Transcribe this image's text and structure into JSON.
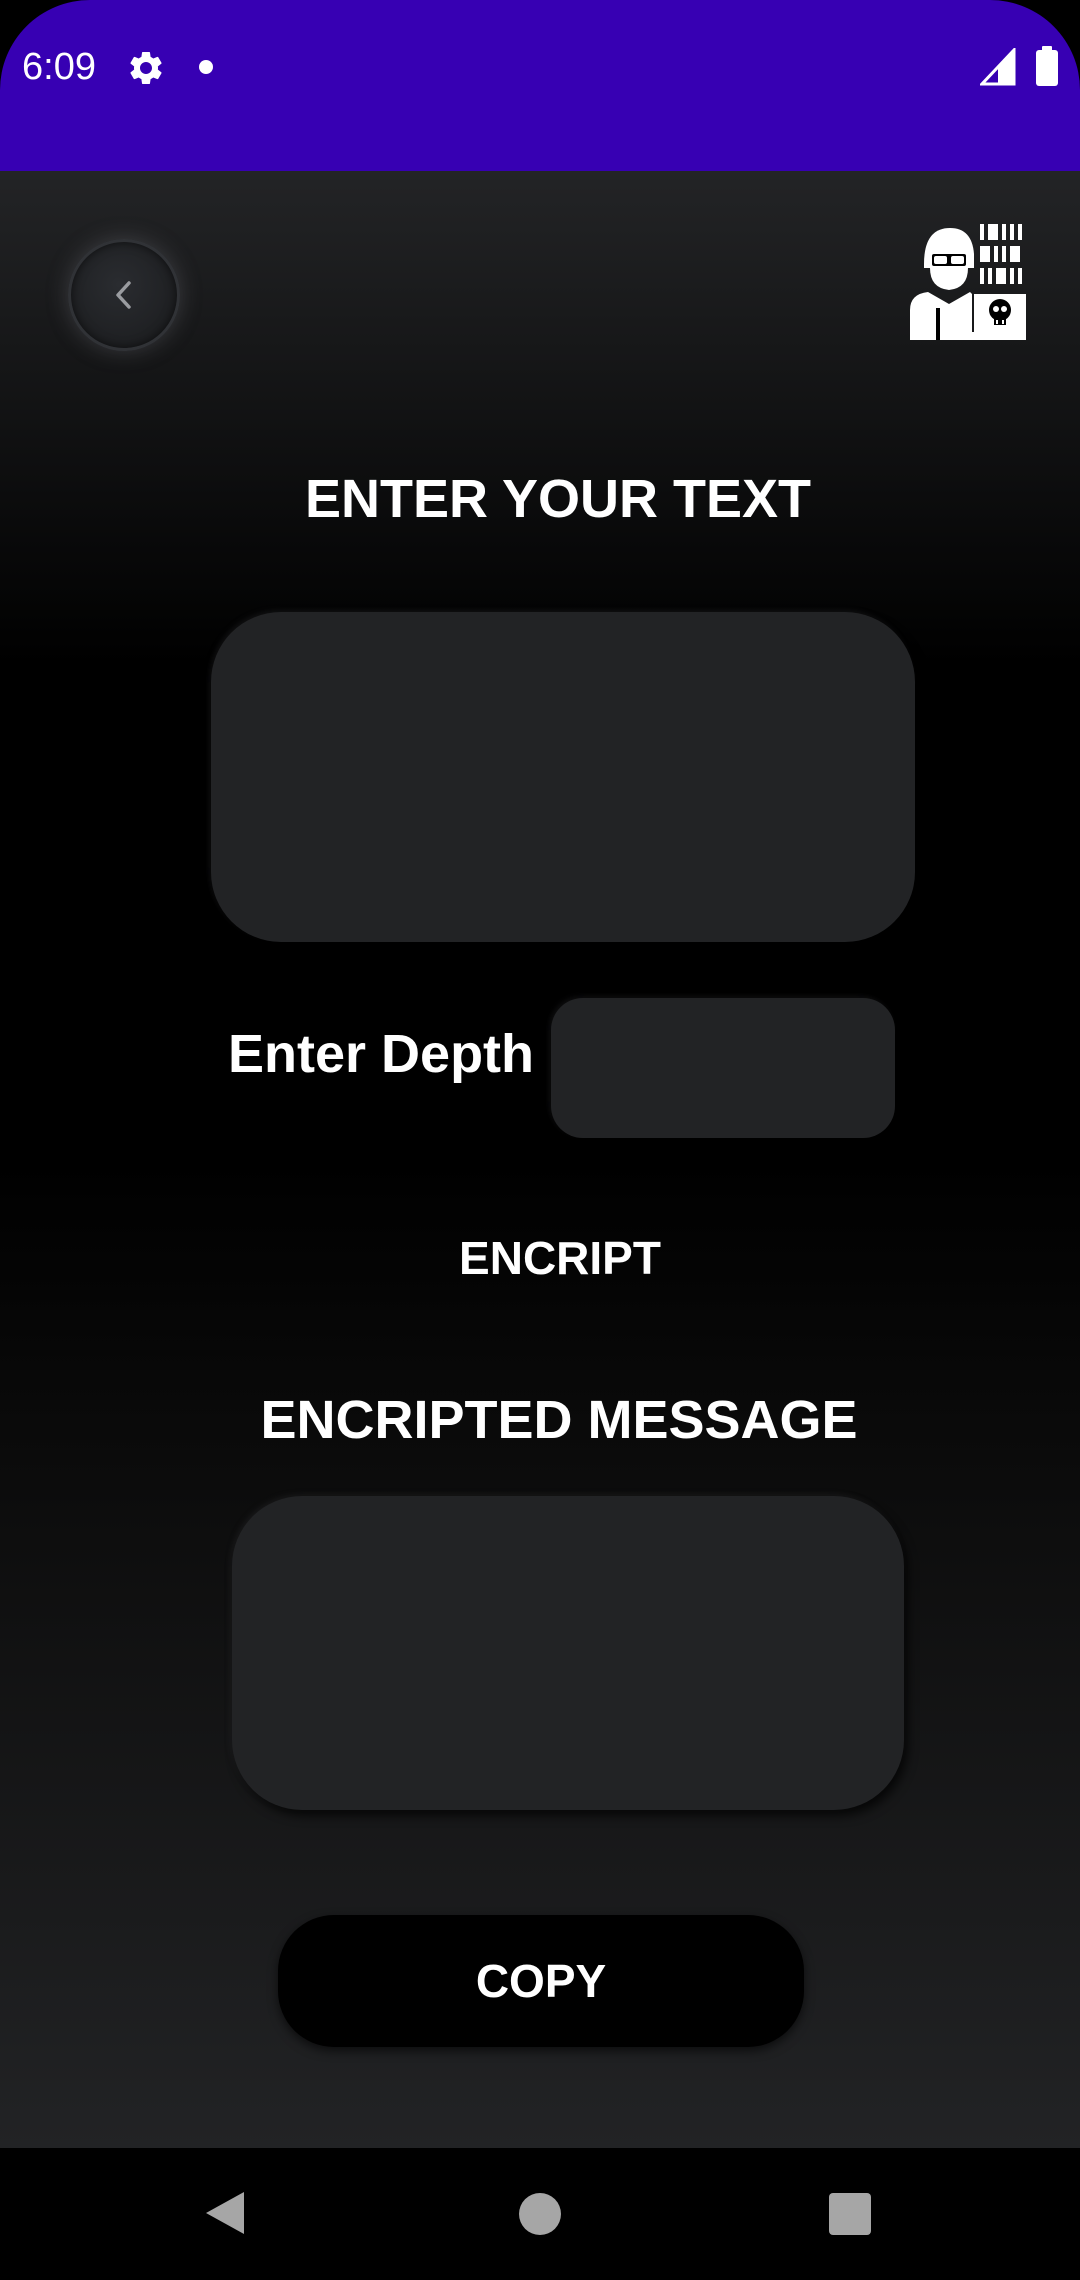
{
  "status_bar": {
    "time": "6:09",
    "background_color": "#3700b3",
    "icons": [
      "gear-icon",
      "notification-dot-icon",
      "signal-icon",
      "battery-icon"
    ]
  },
  "header": {
    "back_icon": "chevron-left-icon",
    "logo_icon": "hacker-icon"
  },
  "input_section": {
    "title": "ENTER YOUR TEXT",
    "text_value": "",
    "depth_label": "Enter Depth",
    "depth_value": ""
  },
  "actions": {
    "encrypt_label": "ENCRIPT",
    "copy_label": "COPY"
  },
  "output_section": {
    "title": "ENCRIPTED MESSAGE",
    "message_value": ""
  },
  "nav_bar": {
    "icons": [
      "back-triangle-icon",
      "home-circle-icon",
      "recents-square-icon"
    ]
  },
  "colors": {
    "surface": "#222325",
    "text": "#ffffff",
    "accent": "#3700b3"
  }
}
